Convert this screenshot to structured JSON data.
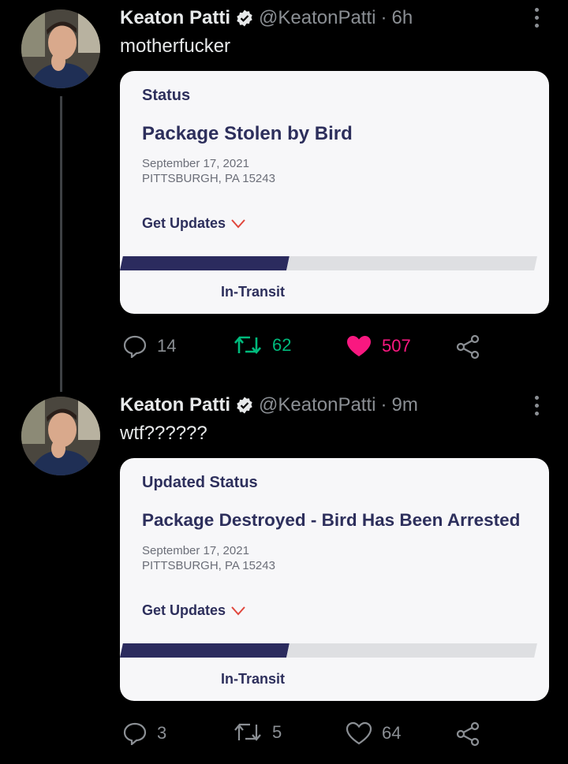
{
  "tweets": [
    {
      "name": "Keaton Patti",
      "handle": "@KeatonPatti",
      "time": "6h",
      "text": "motherfucker",
      "card": {
        "label": "Status",
        "headline": "Package Stolen by Bird",
        "date": "September 17, 2021",
        "location": "PITTSBURGH, PA 15243",
        "get_updates": "Get Updates",
        "progress_label": "In-Transit",
        "progress_fraction": 0.4
      },
      "replies": "14",
      "retweets": "62",
      "likes": "507",
      "retweeted": true,
      "liked": true
    },
    {
      "name": "Keaton Patti",
      "handle": "@KeatonPatti",
      "time": "9m",
      "text": "wtf??????",
      "card": {
        "label": "Updated Status",
        "headline": "Package Destroyed - Bird Has Been Arrested",
        "date": "September 17, 2021",
        "location": "PITTSBURGH, PA 15243",
        "get_updates": "Get Updates",
        "progress_label": "In-Transit",
        "progress_fraction": 0.4
      },
      "replies": "3",
      "retweets": "5",
      "likes": "64",
      "retweeted": false,
      "liked": false
    }
  ],
  "colors": {
    "background": "#000000",
    "accent_green": "#00ba7c",
    "like_pink": "#f91880",
    "verified_white": "#e7e9ea",
    "card_navy": "#2d2f5c",
    "muted": "#8b8f94"
  },
  "icons": [
    "verified-badge-icon",
    "more-icon",
    "reply-icon",
    "retweet-icon",
    "like-icon",
    "share-icon",
    "chevron-down-icon"
  ]
}
